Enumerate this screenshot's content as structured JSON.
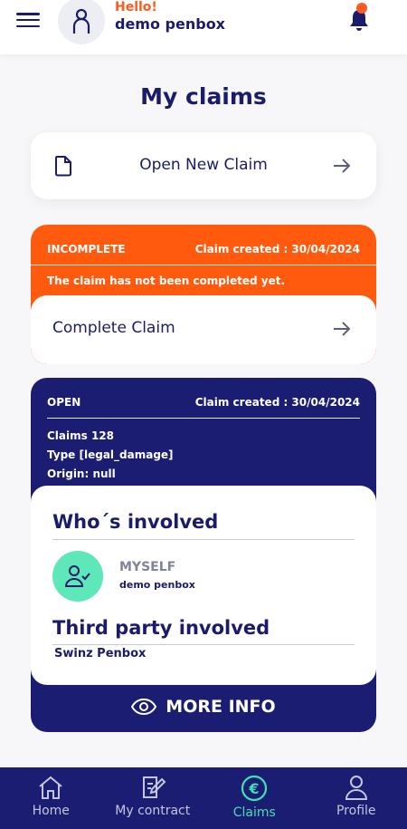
{
  "header": {
    "greeting": "Hello!",
    "username": "demo penbox"
  },
  "page_title": "My claims",
  "new_claim": {
    "label": "Open New Claim"
  },
  "claims": [
    {
      "status": "INCOMPLETE",
      "created": "Claim created : 30/04/2024",
      "message": "The claim has not been completed yet.",
      "action_label": "Complete Claim",
      "color": "#ff5a0e"
    },
    {
      "status": "OPEN",
      "created": "Claim created : 30/04/2024",
      "meta": [
        "Claims 128",
        "Type [legal_damage]",
        "Origin: null"
      ],
      "involved_title": "Who´s involved",
      "involved": {
        "role": "MYSELF",
        "name": "demo penbox"
      },
      "third_party_title": "Third party involved",
      "third_party_name": "Swinz Penbox",
      "more_info_label": "MORE INFO",
      "color": "#1b1d73"
    }
  ],
  "nav": {
    "items": [
      {
        "label": "Home",
        "icon": "home-icon"
      },
      {
        "label": "My contract",
        "icon": "contract-edit-icon"
      },
      {
        "label": "Claims",
        "icon": "euro-icon",
        "active": true
      },
      {
        "label": "Profile",
        "icon": "user-icon"
      }
    ]
  },
  "colors": {
    "primary": "#1b1d73",
    "accent": "#ff5a1f",
    "success": "#3fe0b0"
  }
}
